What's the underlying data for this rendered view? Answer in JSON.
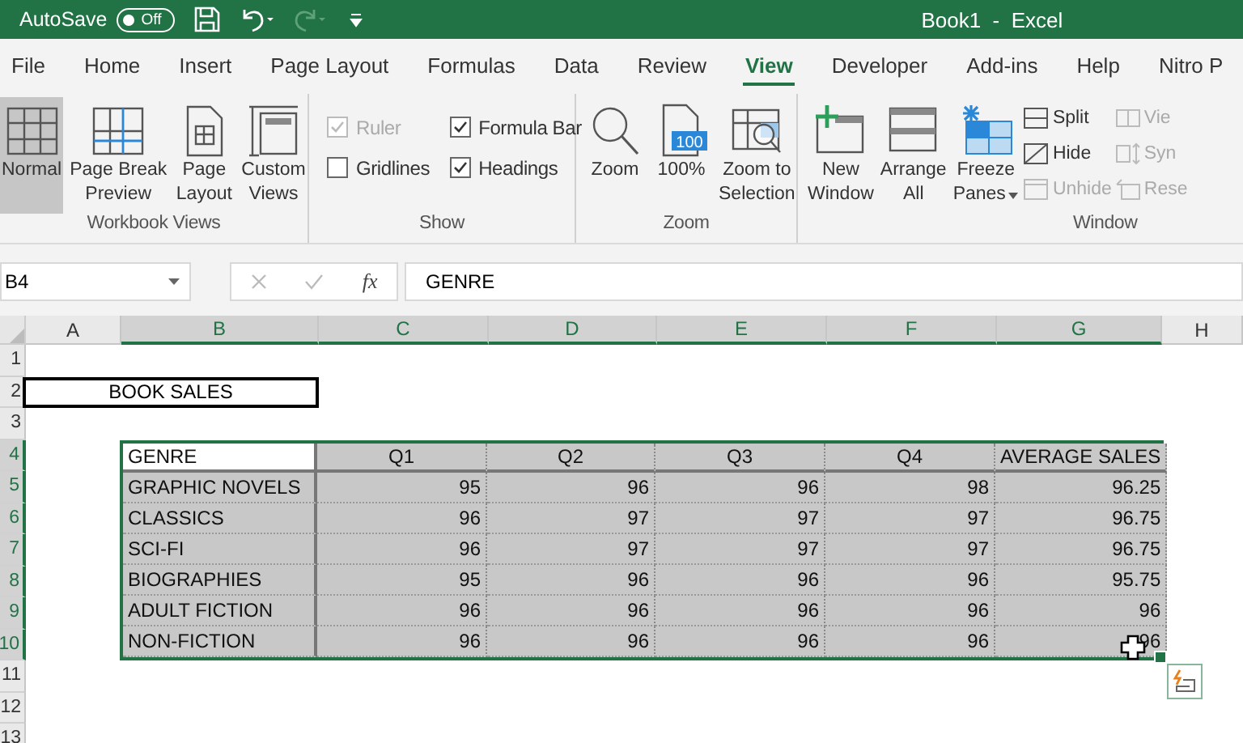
{
  "title_bar": {
    "autosave_label": "AutoSave",
    "autosave_toggle": {
      "label": "Off",
      "on": false
    },
    "title": "Book1  -  Excel"
  },
  "tabs": [
    {
      "label": "File",
      "selected": false
    },
    {
      "label": "Home",
      "selected": false
    },
    {
      "label": "Insert",
      "selected": false
    },
    {
      "label": "Page Layout",
      "selected": false
    },
    {
      "label": "Formulas",
      "selected": false
    },
    {
      "label": "Data",
      "selected": false
    },
    {
      "label": "Review",
      "selected": false
    },
    {
      "label": "View",
      "selected": true
    },
    {
      "label": "Developer",
      "selected": false
    },
    {
      "label": "Add-ins",
      "selected": false
    },
    {
      "label": "Help",
      "selected": false
    },
    {
      "label": "Nitro P",
      "selected": false
    }
  ],
  "ribbon": {
    "groups": [
      {
        "name": "Workbook Views",
        "items": [
          {
            "kind": "large",
            "lines": [
              "Normal"
            ],
            "selected": true
          },
          {
            "kind": "large",
            "lines": [
              "Page Break",
              "Preview"
            ],
            "selected": false
          },
          {
            "kind": "large",
            "lines": [
              "Page",
              "Layout"
            ],
            "selected": false
          },
          {
            "kind": "large",
            "lines": [
              "Custom",
              "Views"
            ],
            "selected": false
          }
        ]
      },
      {
        "name": "Show",
        "items": [
          {
            "kind": "check",
            "label": "Ruler",
            "checked": true,
            "disabled": true
          },
          {
            "kind": "check",
            "label": "Gridlines",
            "checked": false,
            "disabled": false
          },
          {
            "kind": "check",
            "label": "Formula Bar",
            "checked": true,
            "disabled": false
          },
          {
            "kind": "check",
            "label": "Headings",
            "checked": true,
            "disabled": false
          }
        ]
      },
      {
        "name": "Zoom",
        "items": [
          {
            "kind": "large",
            "lines": [
              "Zoom"
            ]
          },
          {
            "kind": "large",
            "lines": [
              "100%"
            ],
            "badge": "100"
          },
          {
            "kind": "large",
            "lines": [
              "Zoom to",
              "Selection"
            ]
          }
        ]
      },
      {
        "name": "Window",
        "items": [
          {
            "kind": "large",
            "lines": [
              "New",
              "Window"
            ]
          },
          {
            "kind": "large",
            "lines": [
              "Arrange",
              "All"
            ]
          },
          {
            "kind": "large",
            "lines": [
              "Freeze",
              "Panes"
            ],
            "menu": true
          },
          {
            "kind": "small",
            "label": "Split",
            "disabled": false
          },
          {
            "kind": "small",
            "label": "Hide",
            "disabled": false
          },
          {
            "kind": "small",
            "label": "Unhide",
            "disabled": true
          },
          {
            "kind": "small",
            "label": "Vie",
            "disabled": true
          },
          {
            "kind": "small",
            "label": "Syn",
            "disabled": true
          },
          {
            "kind": "small",
            "label": "Rese",
            "disabled": true
          }
        ]
      }
    ]
  },
  "formula_bar": {
    "name_box": "B4",
    "fx": "fx",
    "formula": "GENRE"
  },
  "sheet": {
    "columns": [
      {
        "label": "A",
        "selected": false
      },
      {
        "label": "B",
        "selected": true
      },
      {
        "label": "C",
        "selected": true
      },
      {
        "label": "D",
        "selected": true
      },
      {
        "label": "E",
        "selected": true
      },
      {
        "label": "F",
        "selected": true
      },
      {
        "label": "G",
        "selected": true
      },
      {
        "label": "H",
        "selected": false
      }
    ],
    "rows": [
      {
        "label": "1",
        "selected": false
      },
      {
        "label": "2",
        "selected": false
      },
      {
        "label": "3",
        "selected": false
      },
      {
        "label": "4",
        "selected": true
      },
      {
        "label": "5",
        "selected": true
      },
      {
        "label": "6",
        "selected": true
      },
      {
        "label": "7",
        "selected": true
      },
      {
        "label": "8",
        "selected": true
      },
      {
        "label": "9",
        "selected": true
      },
      {
        "label": "10",
        "selected": true
      },
      {
        "label": "11",
        "selected": false
      },
      {
        "label": "12",
        "selected": false
      },
      {
        "label": "13",
        "selected": false
      }
    ],
    "title_cell": "BOOK SALES",
    "table": {
      "header": [
        {
          "text": "GENRE",
          "active": true
        },
        {
          "text": "Q1",
          "active": false
        },
        {
          "text": "Q2",
          "active": false
        },
        {
          "text": "Q3",
          "active": false
        },
        {
          "text": "Q4",
          "active": false
        },
        {
          "text": "AVERAGE SALES",
          "active": false
        }
      ],
      "rows": [
        [
          "GRAPHIC NOVELS",
          "95",
          "96",
          "96",
          "98",
          "96.25"
        ],
        [
          "CLASSICS",
          "96",
          "97",
          "97",
          "97",
          "96.75"
        ],
        [
          "SCI-FI",
          "96",
          "97",
          "97",
          "97",
          "96.75"
        ],
        [
          "BIOGRAPHIES",
          "95",
          "96",
          "96",
          "96",
          "95.75"
        ],
        [
          "ADULT FICTION",
          "96",
          "96",
          "96",
          "96",
          "96"
        ],
        [
          "NON-FICTION",
          "96",
          "96",
          "96",
          "96",
          "96"
        ]
      ]
    }
  }
}
